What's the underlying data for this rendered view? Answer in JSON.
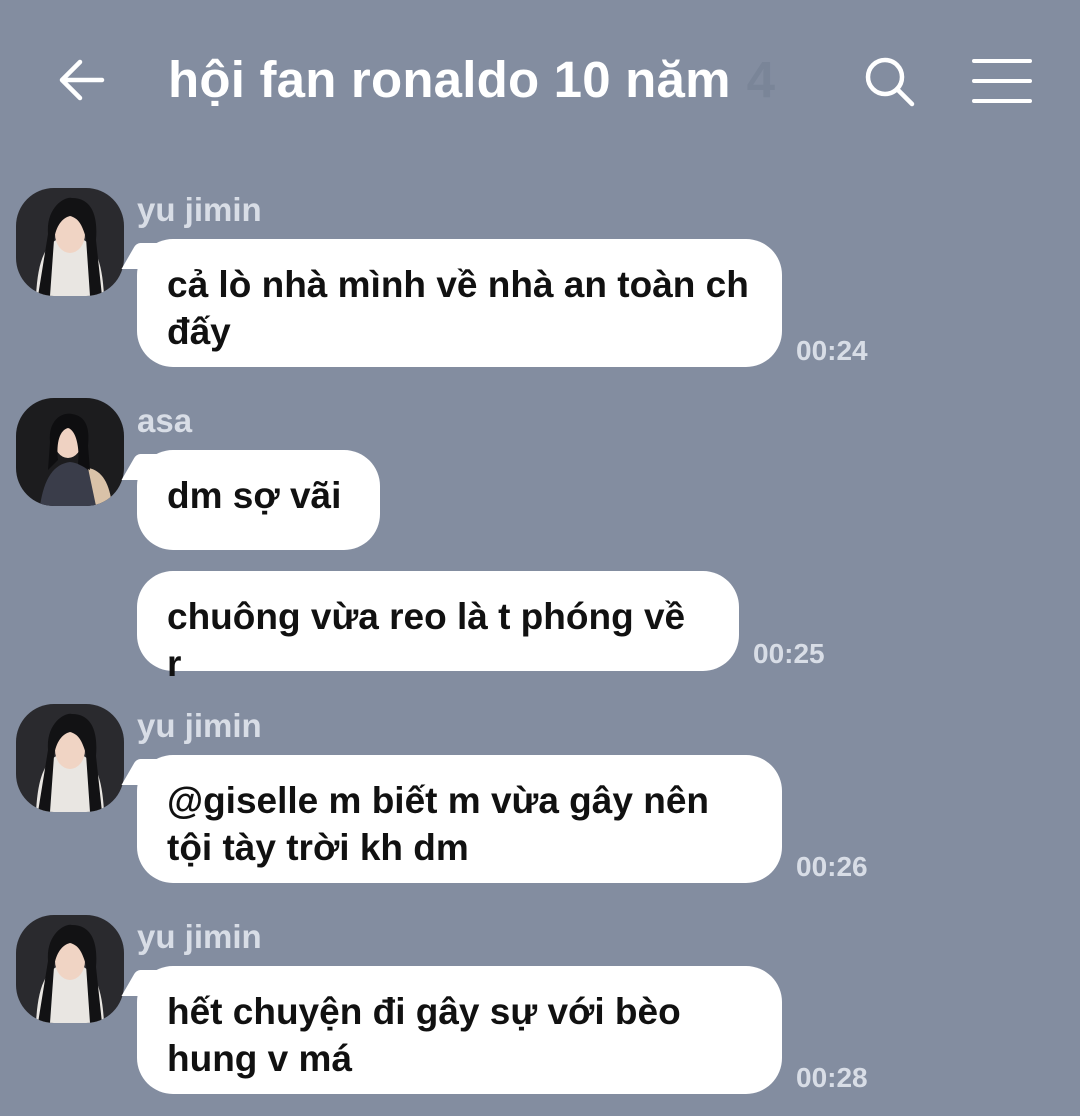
{
  "header": {
    "title": "hội fan ronaldo 10 năm",
    "member_count": "4",
    "back_icon": "arrow-left-icon",
    "search_icon": "search-icon",
    "menu_icon": "hamburger-menu-icon"
  },
  "messages": [
    {
      "sender": "yu jimin",
      "text": "cả lò nhà mình về nhà an toàn ch đấy",
      "time": "00:24"
    },
    {
      "sender": "asa",
      "text": "dm sợ vãi",
      "time": ""
    },
    {
      "sender": "",
      "text": "chuông vừa reo là t phóng về r",
      "time": "00:25"
    },
    {
      "sender": "yu jimin",
      "text": "@giselle m biết m vừa gây nên tội tày trời kh dm",
      "time": "00:26"
    },
    {
      "sender": "yu jimin",
      "text": "hết chuyện đi gây sự với bèo hung v má",
      "time": "00:28"
    }
  ],
  "colors": {
    "background": "#838da0",
    "bubble": "#ffffff",
    "meta_text": "#d8dde6",
    "title_text": "#ffffff"
  }
}
